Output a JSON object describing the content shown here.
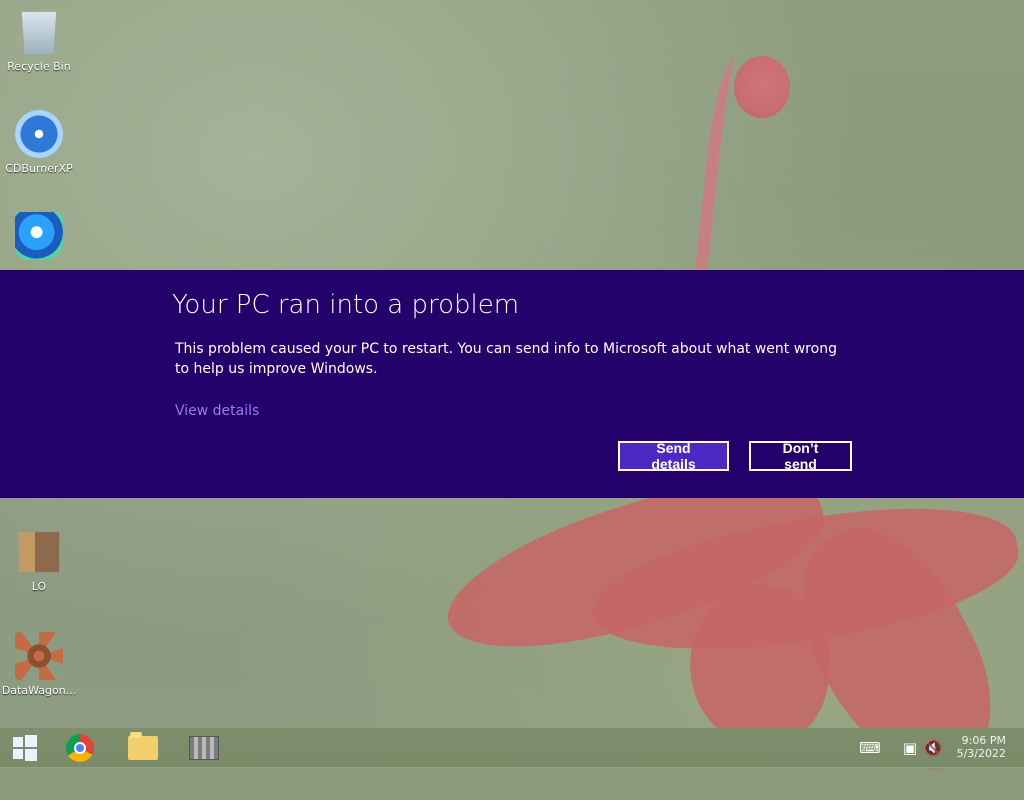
{
  "desktop": {
    "icons": [
      {
        "label": "Recycle Bin",
        "icon": "recycle-bin-icon"
      },
      {
        "label": "CDBurnerXP",
        "icon": "cd-burner-icon"
      },
      {
        "label": "LO",
        "icon": "libreoffice-icon"
      },
      {
        "label": "DataWagon...",
        "icon": "datawagon-icon"
      }
    ]
  },
  "dialog": {
    "title": "Your PC ran into a problem",
    "message": "This problem caused your PC to restart. You can send info to Microsoft about what went wrong to help us improve Windows.",
    "view_details": "View details",
    "send_details": "Send details",
    "dont_send": "Don’t send",
    "colors": {
      "background": "#24006b",
      "link": "#9a79f3",
      "primary_button": "#4d28c2"
    }
  },
  "taskbar": {
    "start_icon": "windows-start-icon",
    "apps": [
      "chrome-icon",
      "file-explorer-icon",
      "firewall-app-icon"
    ],
    "tray_icons": [
      "keyboard-icon",
      "network-icon",
      "volume-muted-icon"
    ],
    "time": "9:06 PM",
    "date": "5/3/2022"
  }
}
